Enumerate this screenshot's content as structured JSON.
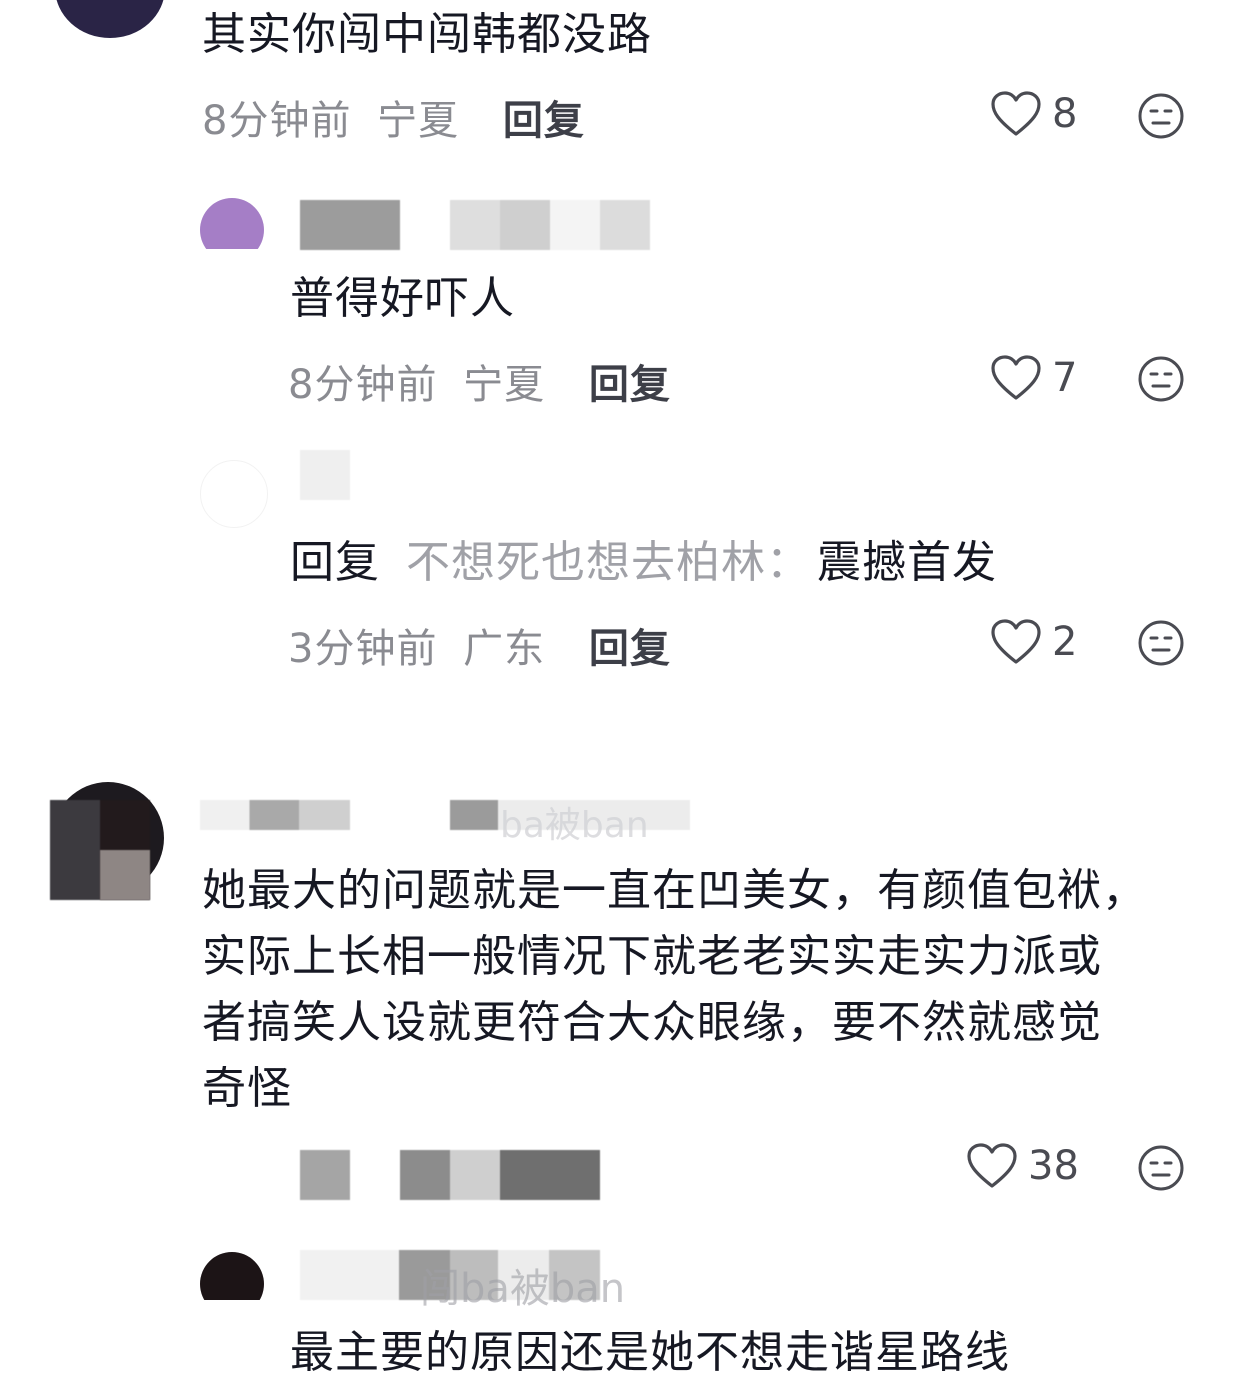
{
  "comments": [
    {
      "text": "其实你闯中闯韩都没路",
      "time": "8分钟前",
      "location": "宁夏",
      "reply_label": "回复",
      "likes": "8"
    },
    {
      "text": "普得好吓人",
      "time": "8分钟前",
      "location": "宁夏",
      "reply_label": "回复",
      "likes": "7"
    },
    {
      "reply_prefix": "回复",
      "reply_to": "不想死也想去柏林：",
      "text": "震撼首发",
      "time": "3分钟前",
      "location": "广东",
      "reply_label": "回复",
      "likes": "2"
    },
    {
      "username_partial": "ba被ban",
      "text_lines": [
        "她最大的问题就是一直在凹美女，有颜值包袱，",
        "实际上长相一般情况下就老老实实走实力派或",
        "者搞笑人设就更符合大众眼缘，要不然就感觉",
        "奇怪"
      ],
      "likes": "38"
    },
    {
      "username_partial": "闯ba被ban",
      "text": "最主要的原因还是她不想走谐星路线"
    }
  ],
  "icons": {
    "like": "heart-outline-icon",
    "dislike": "meh-face-icon"
  },
  "colors": {
    "text": "#161823",
    "meta": "#8a8b91",
    "icon": "#4a4b52"
  }
}
